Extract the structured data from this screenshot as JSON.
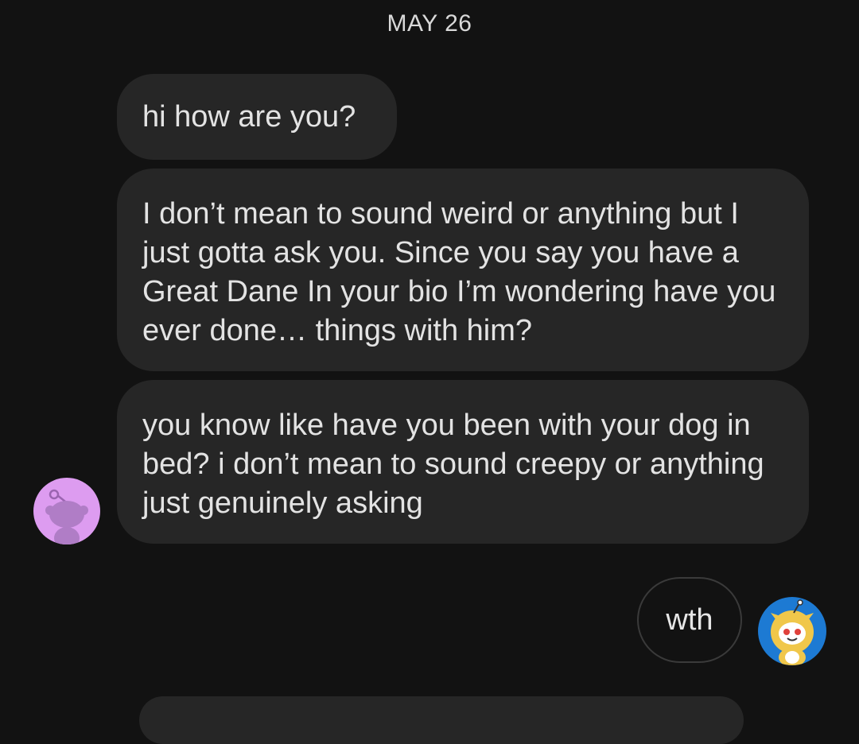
{
  "conversation": {
    "date_divider": "MAY 26",
    "messages": [
      {
        "sender": "other",
        "text": "hi how are you?"
      },
      {
        "sender": "other",
        "text": "I don’t mean to sound weird or anything but I just gotta ask you. Since you say you have a Great Dane In your bio I’m wondering have you ever done… things with him?"
      },
      {
        "sender": "other",
        "text": "you know like have you been with your dog in bed? i don’t mean to sound creepy or anything just genuinely asking"
      },
      {
        "sender": "self",
        "text": "wth"
      }
    ]
  },
  "avatars": {
    "other": {
      "icon": "snoo-avatar-icon",
      "color": "#dd9cf0"
    },
    "self": {
      "icon": "snoo-lion-avatar-icon",
      "color": "#1d7ad3"
    }
  },
  "colors": {
    "background": "#121212",
    "incoming_bubble": "#262626",
    "outgoing_bubble_border": "#3a3a3a",
    "text": "#e3e3e3"
  }
}
